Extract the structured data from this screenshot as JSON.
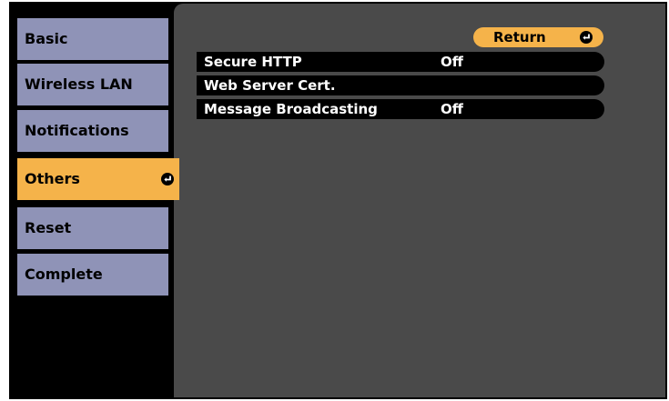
{
  "sidebar": {
    "items": [
      {
        "label": "Basic",
        "selected": false
      },
      {
        "label": "Wireless LAN",
        "selected": false
      },
      {
        "label": "Notifications",
        "selected": false
      },
      {
        "label": "Others",
        "selected": true
      },
      {
        "label": "Reset",
        "selected": false
      },
      {
        "label": "Complete",
        "selected": false
      }
    ]
  },
  "panel": {
    "return_label": "Return",
    "rows": [
      {
        "label": "Secure HTTP",
        "value": "Off"
      },
      {
        "label": "Web Server Cert.",
        "value": ""
      },
      {
        "label": "Message Broadcasting",
        "value": "Off"
      }
    ]
  },
  "colors": {
    "sidebar_item": "#8f93b7",
    "selected": "#f5b34a",
    "panel": "#4a4a4a",
    "frame": "#000000"
  },
  "icons": {
    "enter": "enter-icon"
  }
}
